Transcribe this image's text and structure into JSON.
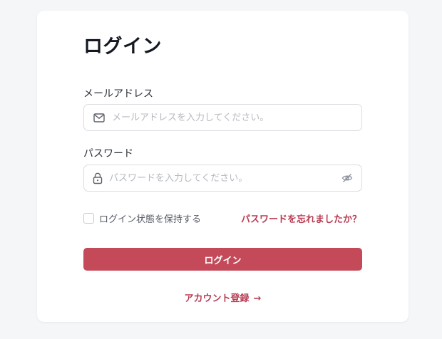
{
  "login_form": {
    "title": "ログイン",
    "email": {
      "label": "メールアドレス",
      "placeholder": "メールアドレスを入力してください。",
      "value": "",
      "icon": "mail-icon"
    },
    "password": {
      "label": "パスワード",
      "placeholder": "パスワードを入力してください。",
      "value": "",
      "icon": "lock-icon",
      "toggle_icon": "eye-off-icon"
    },
    "remember": {
      "label": "ログイン状態を保持する",
      "checked": false
    },
    "forgot_link": "パスワードを忘れましたか？",
    "submit_label": "ログイン",
    "register_link": "アカウント登録",
    "register_arrow": "→"
  },
  "colors": {
    "accent": "#c44a5a",
    "link": "#b83d53",
    "background": "#f5f6f8",
    "card": "#ffffff",
    "input_border": "#d9dce2"
  }
}
